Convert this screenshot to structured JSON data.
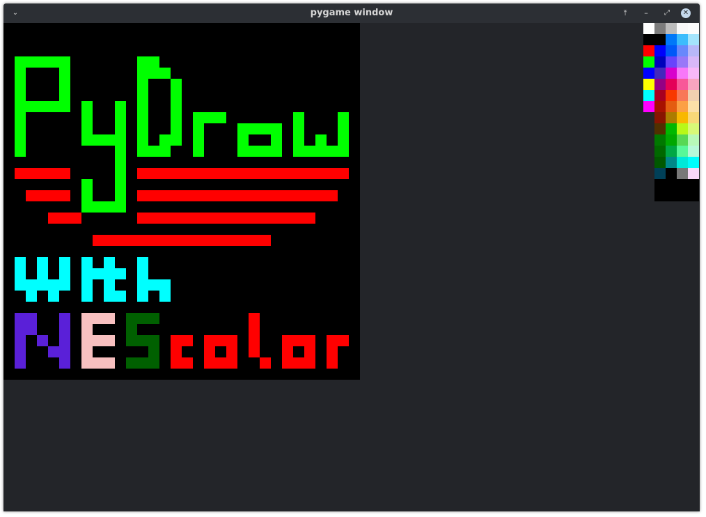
{
  "window": {
    "title": "pygame window",
    "menu_icon": "chevron-down-icon",
    "pin_icon": "pin-icon",
    "minimize_icon": "minimize-icon",
    "maximize_icon": "maximize-icon",
    "close_icon": "close-icon"
  },
  "colors": {
    "window_bg": "#232529",
    "titlebar_bg": "#2c2f34",
    "canvas_bg": "#000000",
    "green": "#00ff00",
    "red": "#ff0000",
    "cyan": "#00ffff",
    "purple": "#5a20d8",
    "pink": "#f8c0c0",
    "dark_green": "#006000"
  },
  "canvas": {
    "artwork": "PyDraw with NEScolor"
  },
  "palette": {
    "basic_colors": [
      "#ffffff",
      "#000000",
      "#ff0000",
      "#00ff00",
      "#0000ff",
      "#ffff00",
      "#00ffff",
      "#ff00ff"
    ],
    "nes_columns": [
      [
        "#7c7c7c",
        "#000000",
        "#0000fc",
        "#0000bc",
        "#4428bc",
        "#940084",
        "#a80020",
        "#a81000",
        "#881400",
        "#503000",
        "#007800",
        "#006800",
        "#005800",
        "#004058",
        "#000000",
        "#000000"
      ],
      [
        "#bcbcbc",
        "#0078f8",
        "#0058f8",
        "#6844fc",
        "#d800cc",
        "#e40058",
        "#f83800",
        "#e45c10",
        "#ac7c00",
        "#00b800",
        "#00a800",
        "#00a844",
        "#008888",
        "#000000",
        "#000000",
        "#000000"
      ],
      [
        "#f8f8f8",
        "#3cbcfc",
        "#6888fc",
        "#9878f8",
        "#f878f8",
        "#f85898",
        "#f87858",
        "#fca044",
        "#f8b800",
        "#b8f818",
        "#58d854",
        "#58f898",
        "#00e8d8",
        "#787878",
        "#000000",
        "#000000"
      ],
      [
        "#fcfcfc",
        "#a4e4fc",
        "#b8b8f8",
        "#d8b8f8",
        "#f8b8f8",
        "#f8a4c0",
        "#f0d0b0",
        "#fce0a8",
        "#f8d878",
        "#d8f878",
        "#b8f8b8",
        "#b8f8d8",
        "#00fcfc",
        "#f8d8f8",
        "#000000",
        "#000000"
      ]
    ]
  }
}
